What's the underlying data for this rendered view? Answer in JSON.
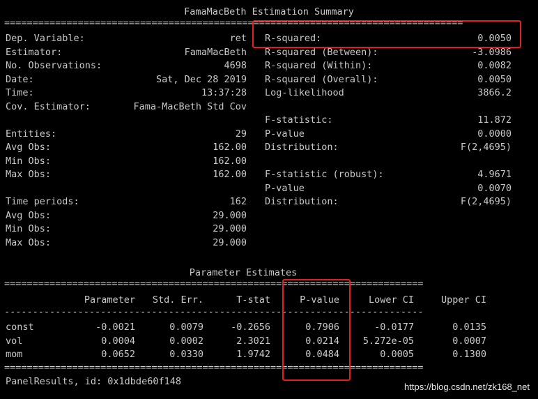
{
  "summary": {
    "title": "FamaMacBeth Estimation Summary",
    "rule": "=================================================================================",
    "left": [
      {
        "label": "Dep. Variable:",
        "value": "ret"
      },
      {
        "label": "Estimator:",
        "value": "FamaMacBeth"
      },
      {
        "label": "No. Observations:",
        "value": "4698"
      },
      {
        "label": "Date:",
        "value": "Sat, Dec 28 2019"
      },
      {
        "label": "Time:",
        "value": "13:37:28"
      },
      {
        "label": "Cov. Estimator:",
        "value": "Fama-MacBeth Std Cov"
      },
      {
        "label": "",
        "value": ""
      },
      {
        "label": "Entities:",
        "value": "29"
      },
      {
        "label": "Avg Obs:",
        "value": "162.00"
      },
      {
        "label": "Min Obs:",
        "value": "162.00"
      },
      {
        "label": "Max Obs:",
        "value": "162.00"
      },
      {
        "label": "",
        "value": ""
      },
      {
        "label": "Time periods:",
        "value": "162"
      },
      {
        "label": "Avg Obs:",
        "value": "29.000"
      },
      {
        "label": "Min Obs:",
        "value": "29.000"
      },
      {
        "label": "Max Obs:",
        "value": "29.000"
      }
    ],
    "right": [
      {
        "label": "R-squared:",
        "value": "0.0050"
      },
      {
        "label": "R-squared (Between):",
        "value": "-3.0986"
      },
      {
        "label": "R-squared (Within):",
        "value": "0.0082"
      },
      {
        "label": "R-squared (Overall):",
        "value": "0.0050"
      },
      {
        "label": "Log-likelihood",
        "value": "3866.2"
      },
      {
        "label": "",
        "value": ""
      },
      {
        "label": "F-statistic:",
        "value": "11.872"
      },
      {
        "label": "P-value",
        "value": "0.0000"
      },
      {
        "label": "Distribution:",
        "value": "F(2,4695)"
      },
      {
        "label": "",
        "value": ""
      },
      {
        "label": "F-statistic (robust):",
        "value": "4.9671"
      },
      {
        "label": "P-value",
        "value": "0.0070"
      },
      {
        "label": "Distribution:",
        "value": "F(2,4695)"
      }
    ]
  },
  "params": {
    "title": "Parameter Estimates",
    "rule": "==========================================================================",
    "dash": "--------------------------------------------------------------------------",
    "headers": [
      "Parameter",
      "Std. Err.",
      "T-stat",
      "P-value",
      "Lower CI",
      "Upper CI"
    ],
    "rows": [
      {
        "name": "const",
        "cells": [
          "-0.0021",
          "0.0079",
          "-0.2656",
          "0.7906",
          "-0.0177",
          "0.0135"
        ]
      },
      {
        "name": "vol",
        "cells": [
          "0.0004",
          "0.0002",
          "2.3021",
          "0.0214",
          "5.272e-05",
          "0.0007"
        ]
      },
      {
        "name": "mom",
        "cells": [
          "0.0652",
          "0.0330",
          "1.9742",
          "0.0484",
          "0.0005",
          "0.1300"
        ]
      }
    ]
  },
  "footer": "PanelResults, id: 0x1dbde60f148",
  "watermark": "https://blog.csdn.net/zk168_net",
  "colors": {
    "background": "#000000",
    "text": "#c9c9c9",
    "highlight": "#e02020"
  }
}
